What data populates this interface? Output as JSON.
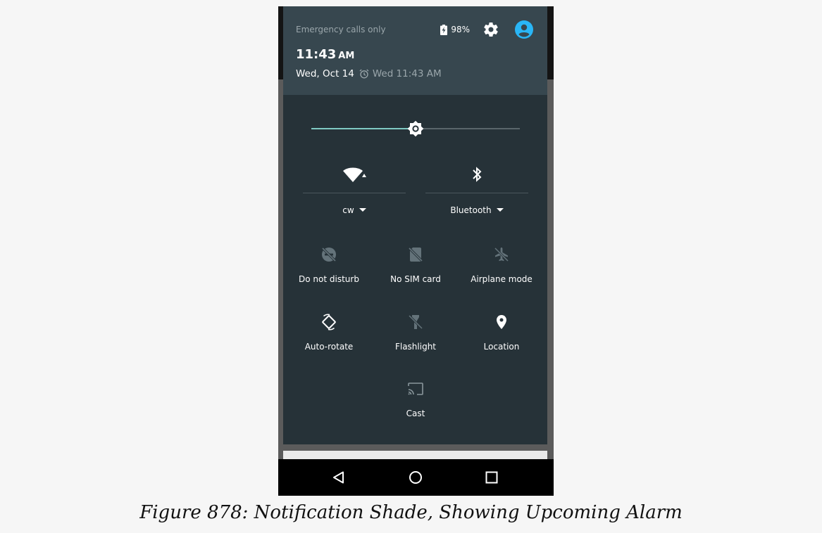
{
  "status_bar": {
    "carrier": "Emergency calls only",
    "battery": "98%",
    "time": "11:43",
    "ampm": "AM",
    "date": "Wed, Oct 14",
    "alarm": "Wed 11:43 AM"
  },
  "brightness": {
    "level": 0.5
  },
  "big_tiles": {
    "wifi_label": "cw",
    "bluetooth_label": "Bluetooth"
  },
  "tiles": {
    "dnd": "Do not disturb",
    "sim": "No SIM card",
    "airplane": "Airplane mode",
    "rotate": "Auto-rotate",
    "flashlight": "Flashlight",
    "location": "Location",
    "cast": "Cast"
  },
  "caption": "Figure 878: Notification Shade, Showing Upcoming Alarm",
  "colors": {
    "accent": "#80cbc4",
    "avatar": "#29b6f6",
    "shade_bg": "#263238",
    "header_bg": "#37474f"
  }
}
